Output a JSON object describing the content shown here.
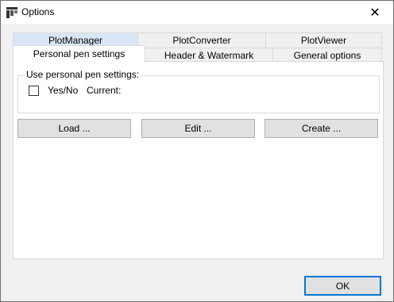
{
  "window": {
    "title": "Options",
    "close_glyph": "✕"
  },
  "tabs": {
    "row1": [
      {
        "label": "PlotManager"
      },
      {
        "label": "PlotConverter"
      },
      {
        "label": "PlotViewer"
      }
    ],
    "row2": [
      {
        "label": "Personal pen settings"
      },
      {
        "label": "Header & Watermark"
      },
      {
        "label": "General options"
      }
    ]
  },
  "panel": {
    "group_title": "Use personal pen settings:",
    "checkbox_label": "Yes/No",
    "checked": false,
    "current_label": "Current:",
    "buttons": {
      "load": "Load ...",
      "edit": "Edit ...",
      "create": "Create ..."
    }
  },
  "footer": {
    "ok_label": "OK"
  },
  "colors": {
    "accent": "#0078d7",
    "tab_highlight": "#d9e6f5",
    "button_face": "#e1e1e1"
  }
}
